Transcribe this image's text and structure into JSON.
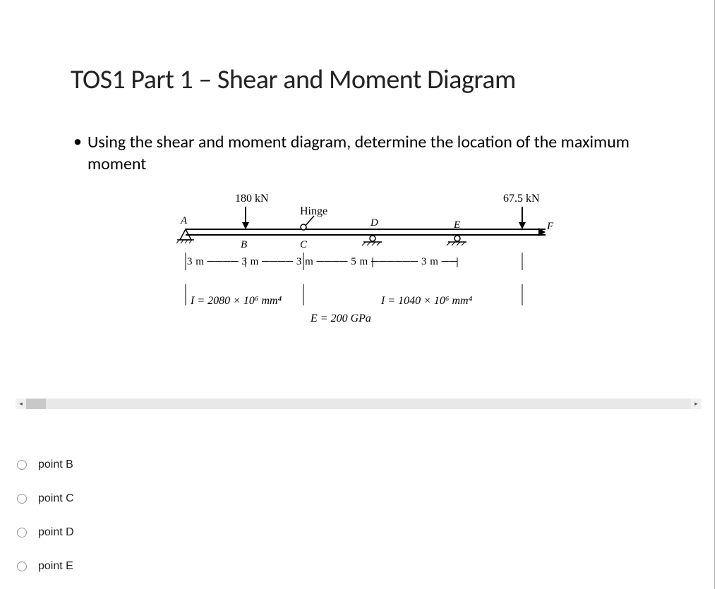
{
  "title": "TOS1 Part 1 – Shear and Moment Diagram",
  "bullet_glyph": "•",
  "instruction": "Using the shear and moment diagram, determine the location of the maximum moment",
  "diagram": {
    "load1": "180 kN",
    "load2": "67.5 kN",
    "hinge": "Hinge",
    "pt_A": "A",
    "pt_B": "B",
    "pt_C": "C",
    "pt_D": "D",
    "pt_E": "E",
    "pt_F": "F",
    "dims": "3 m ──── 3 m ──── 3 m ──── 5 m ────── 3 m ──",
    "I1": "I = 2080 × 10⁶ mm⁴",
    "I2": "I = 1040 × 10⁶ mm⁴",
    "E": "E = 200 GPa"
  },
  "options": [
    {
      "label": "point B"
    },
    {
      "label": "point C"
    },
    {
      "label": "point D"
    },
    {
      "label": "point E"
    }
  ],
  "scroll": {
    "left": "◂",
    "right": "▸"
  }
}
